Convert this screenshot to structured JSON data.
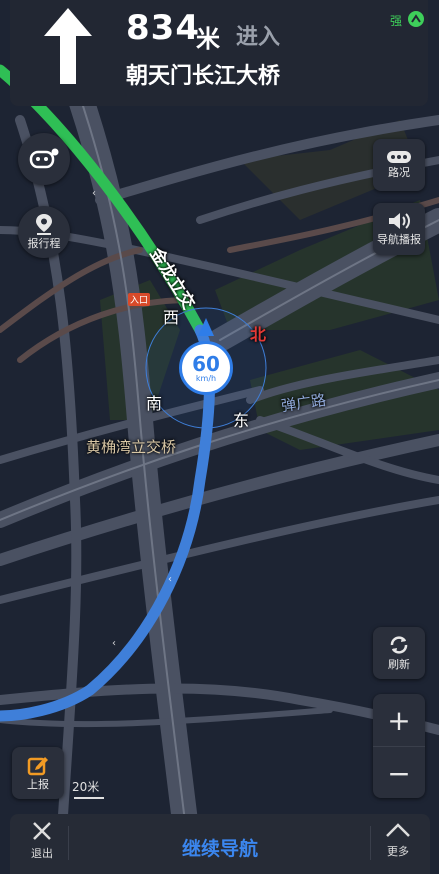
{
  "guidance": {
    "distance": "834",
    "unit": "米",
    "action": "进入",
    "road": "朝天门长江大桥",
    "signal": "强"
  },
  "map": {
    "roads": {
      "jinlong": "金龙立交",
      "huangjuewan": "黄桷湾立交桥",
      "danguang": "弹广路",
      "entrance": "入口"
    },
    "compass": {
      "west": "西",
      "north": "北",
      "south": "南",
      "east": "东"
    },
    "speed": {
      "value": "60",
      "unit": "km/h"
    },
    "scale": "20米",
    "colors": {
      "route": "#3f7fd9",
      "traffic_smooth": "#2fbf55",
      "north": "#e53935"
    }
  },
  "buttons": {
    "robot": "",
    "report_trip": "报行程",
    "traffic": "路况",
    "nav_broadcast": "导航播报",
    "refresh": "刷新",
    "zoom_in": "+",
    "zoom_out": "−",
    "report": "上报"
  },
  "bottom_bar": {
    "exit": "退出",
    "continue": "继续导航",
    "more": "更多"
  }
}
